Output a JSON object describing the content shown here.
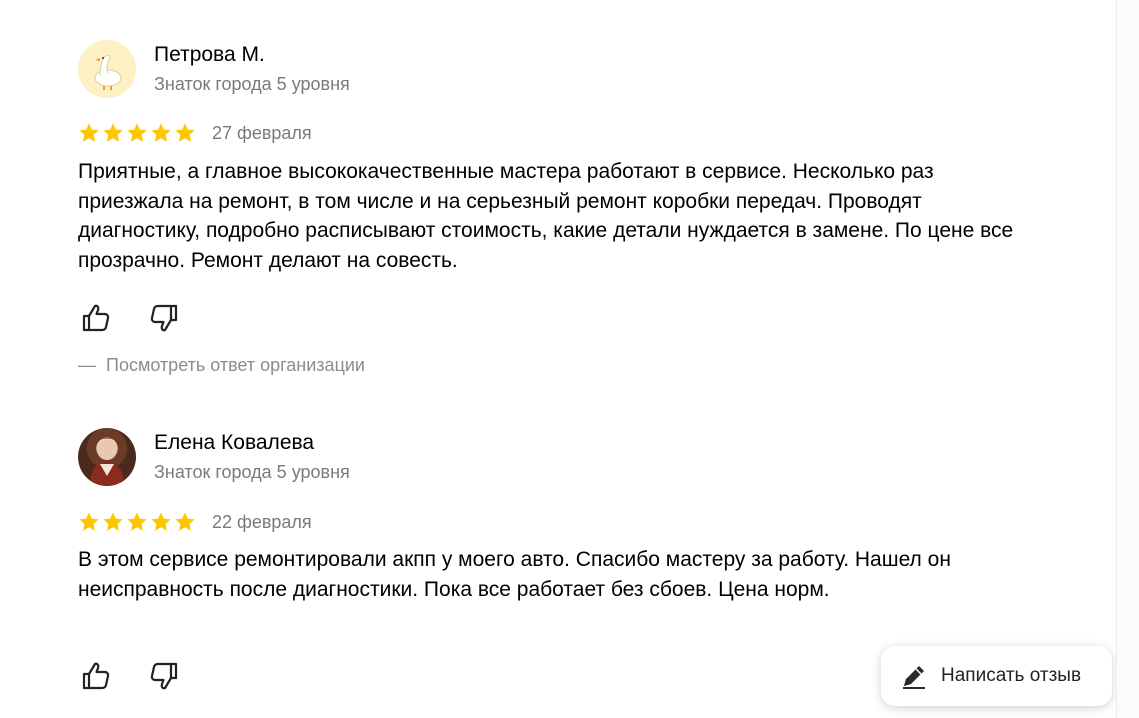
{
  "reviews": [
    {
      "author": "Петрова М.",
      "level": "Знаток города 5 уровня",
      "rating": 5,
      "date": "27 февраля",
      "text": "Приятные, а главное высококачественные мастера работают в сервисе. Несколько раз приезжала на ремонт, в том числе и на серьезный ремонт коробки передач. Проводят диагностику, подробно расписывают стоимость, какие детали нуждается в замене. По цене все прозрачно. Ремонт делают на совесть.",
      "org_reply_dash": "—",
      "org_reply": "Посмотреть ответ организации"
    },
    {
      "author": "Елена Ковалева",
      "level": "Знаток города 5 уровня",
      "rating": 5,
      "date": "22 февраля",
      "text": "В этом сервисе ремонтировали акпп у моего авто. Спасибо мастеру за работу. Нашел он неисправность после диагностики. Пока все работает без сбоев. Цена норм."
    }
  ],
  "write_review": {
    "label": "Написать отзыв"
  },
  "colors": {
    "star": "#fcc700",
    "muted": "#7a7a7a"
  }
}
